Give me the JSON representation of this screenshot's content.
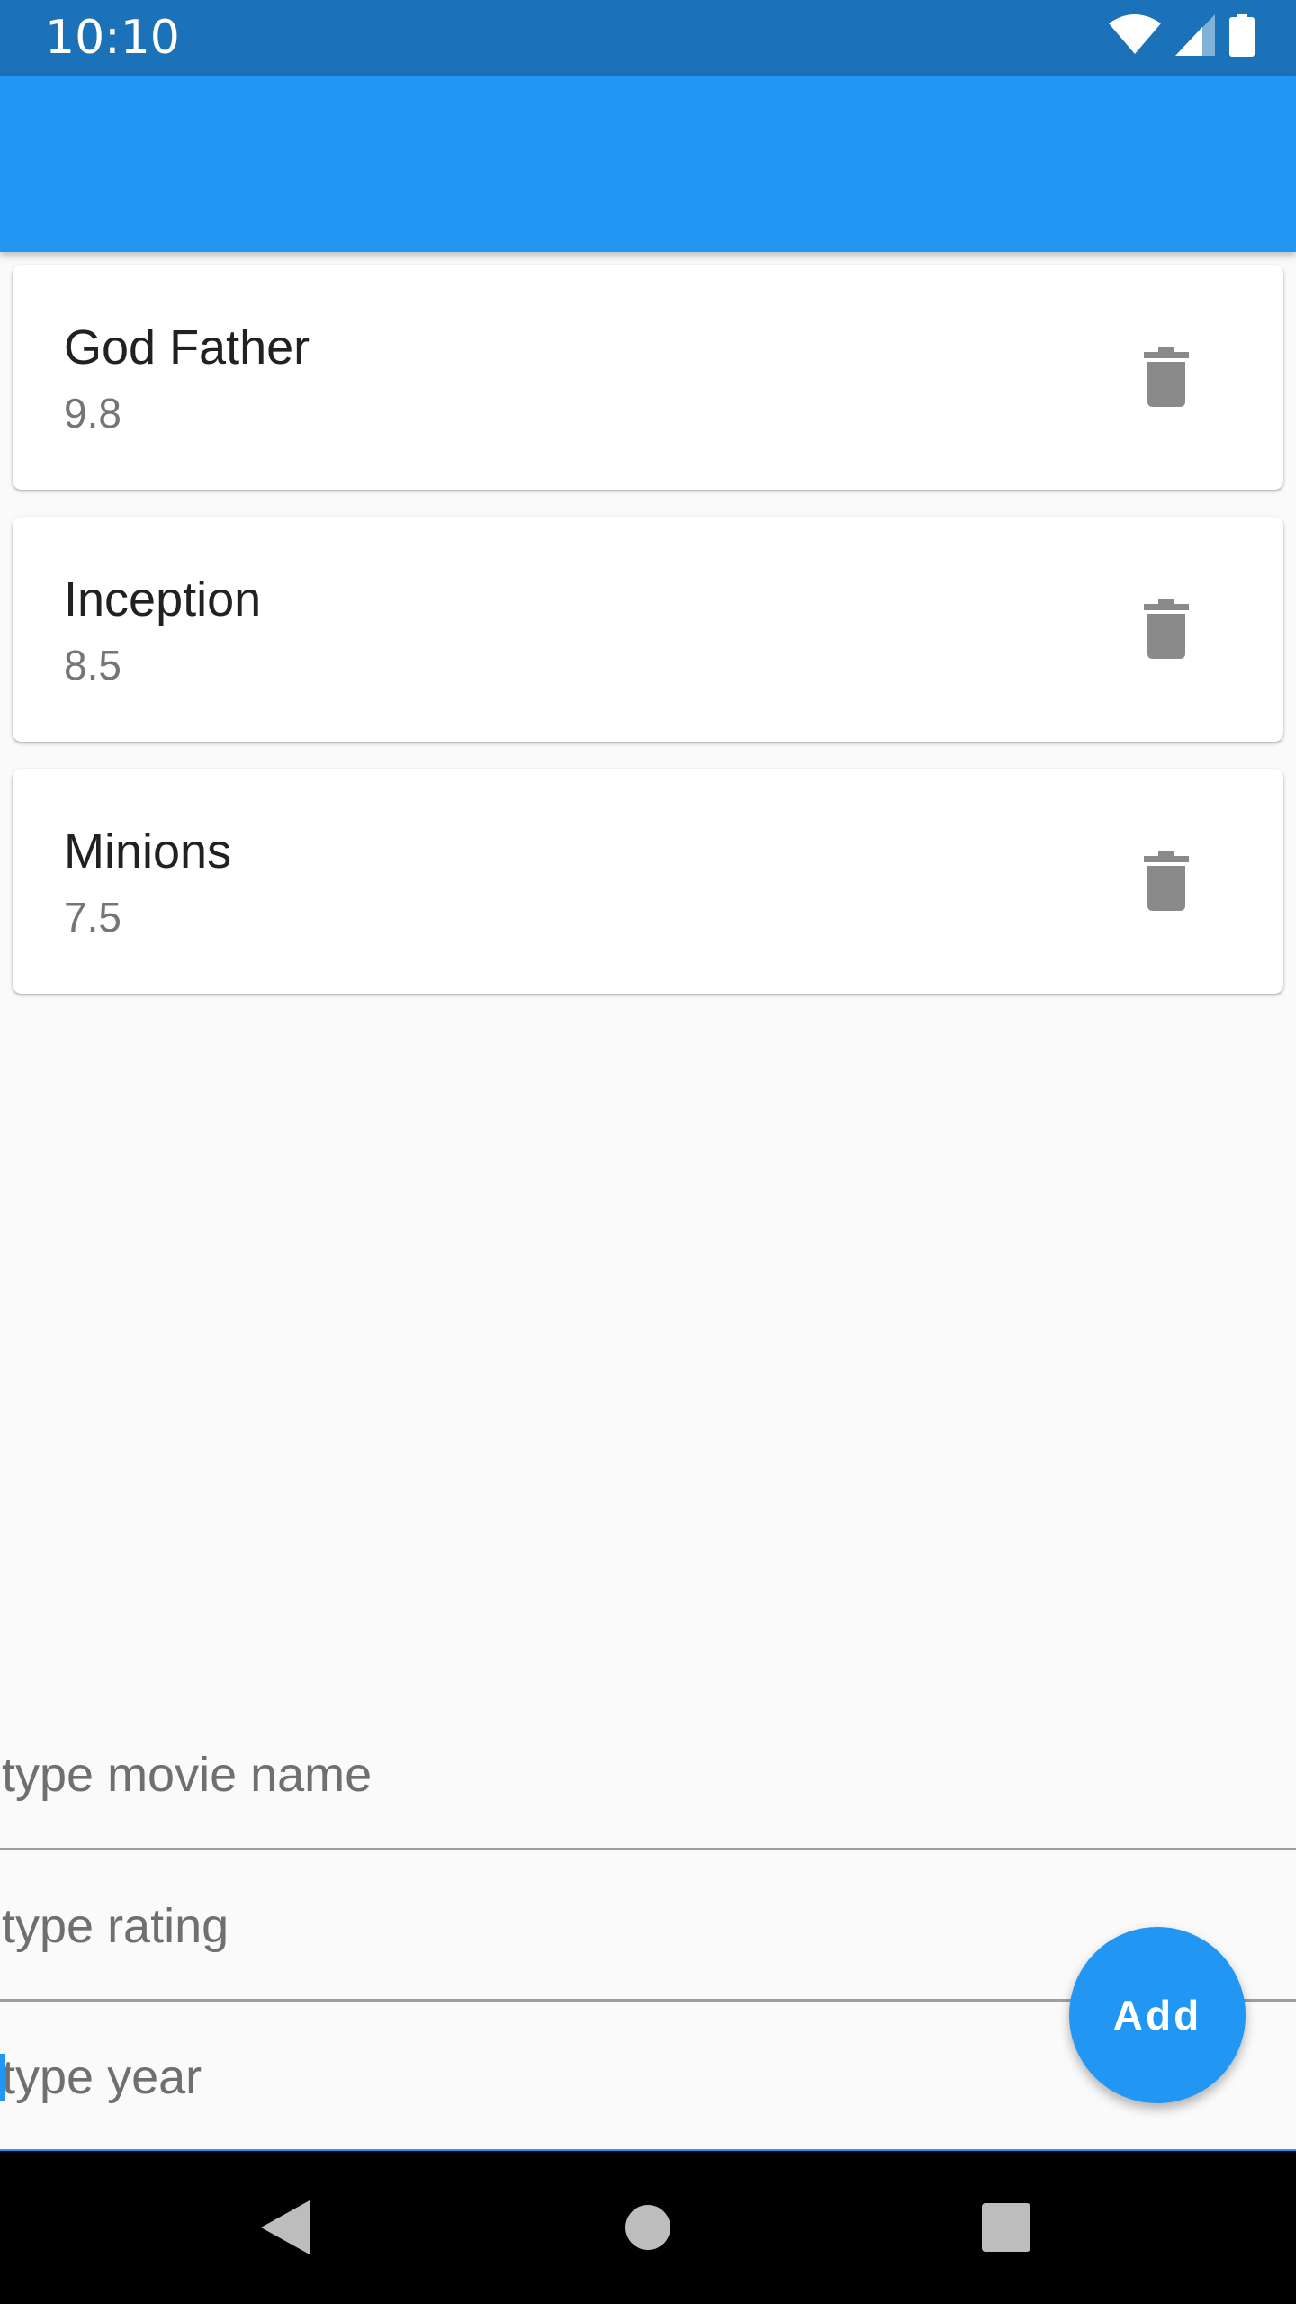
{
  "status_bar": {
    "time": "10:10",
    "icons": [
      "wifi-icon",
      "cell-signal-icon",
      "battery-icon"
    ]
  },
  "app_bar": {
    "title": "",
    "color": "#2196f3"
  },
  "movies": [
    {
      "name": "God Father",
      "rating": "9.8"
    },
    {
      "name": "Inception",
      "rating": "8.5"
    },
    {
      "name": "Minions",
      "rating": "7.5"
    }
  ],
  "form": {
    "name_placeholder": "type movie name",
    "name_value": "",
    "rating_placeholder": "type rating",
    "rating_value": "",
    "year_placeholder": "type year",
    "year_value": ""
  },
  "fab": {
    "label": "Add"
  },
  "nav": {
    "icons": [
      "back-icon",
      "home-icon",
      "recents-icon"
    ]
  },
  "colors": {
    "primary": "#2196f3",
    "status_bar": "#1b72b8",
    "delete_icon": "#8a8a8a"
  }
}
